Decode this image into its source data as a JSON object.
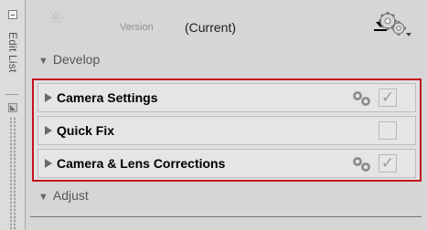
{
  "sidebar": {
    "label": "Edit List",
    "collapse_icon": "minus-box-icon",
    "grip_icon": "resize-grip-icon"
  },
  "header": {
    "logo_icon": "sparkle-icon",
    "version_label": "Version",
    "version_value": "(Current)",
    "settings_icon": "gears-icon"
  },
  "sections": {
    "develop": {
      "label": "Develop"
    },
    "adjust": {
      "label": "Adjust"
    }
  },
  "items": [
    {
      "label": "Camera Settings",
      "linked": true,
      "checked": true,
      "check_glyph": "✓"
    },
    {
      "label": "Quick Fix",
      "linked": false,
      "checked": false,
      "check_glyph": ""
    },
    {
      "label": "Camera & Lens Corrections",
      "linked": true,
      "checked": true,
      "check_glyph": "✓"
    }
  ],
  "colors": {
    "highlight_border": "#c3121f",
    "background": "#d6d6d6"
  }
}
